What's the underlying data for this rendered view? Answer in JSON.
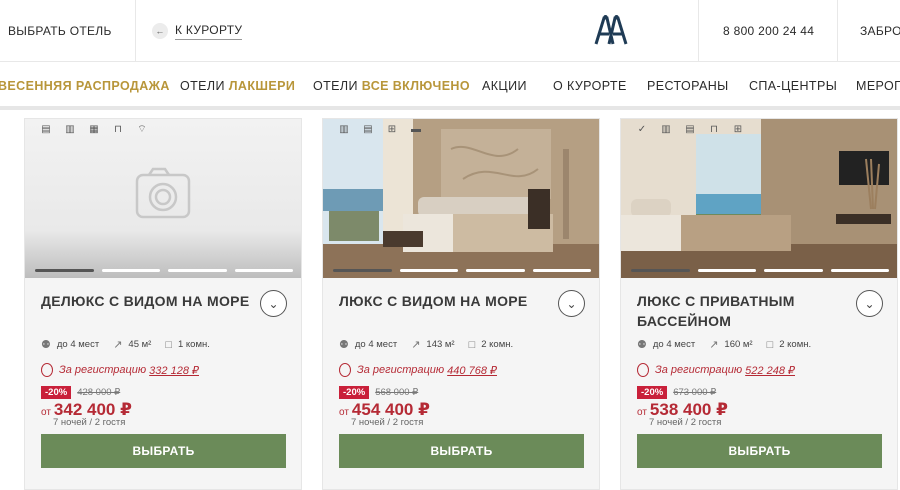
{
  "header": {
    "choose_hotel": "ВЫБРАТЬ ОТЕЛЬ",
    "back_to_resort": "К КУРОРТУ",
    "phone": "8 800 200 24 44",
    "booking_partial": "ЗАБРО"
  },
  "nav": {
    "items": [
      {
        "label": "ВЕСЕННЯЯ РАСПРОДАЖА"
      },
      {
        "prefix": "ОТЕЛИ ",
        "highlight": "ЛАКШЕРИ"
      },
      {
        "prefix": "ОТЕЛИ ",
        "highlight": "ВСЕ ВКЛЮЧЕНО"
      },
      {
        "label": "АКЦИИ"
      },
      {
        "label": "О КУРОРТЕ"
      },
      {
        "label": "РЕСТОРАНЫ"
      },
      {
        "label": "СПА-ЦЕНТРЫ"
      },
      {
        "label": "МЕРОП"
      }
    ]
  },
  "colors": {
    "accent_gold": "#b8963a",
    "price_red": "#b52a35",
    "badge_red": "#c9203a",
    "button_green": "#6b8b59"
  },
  "rooms": [
    {
      "title": "ДЕЛЮКС С ВИДОМ НА МОРЕ",
      "guests": "до 4 мест",
      "area": "45 м²",
      "rooms": "1 комн.",
      "reg_label": "За регистрацию",
      "reg_amount": "332 128 ₽",
      "discount": "-20%",
      "old_price": "428 000 ₽",
      "from": "от",
      "price": "342 400 ₽",
      "nights": "7 ночей / 2 гостя",
      "button": "ВЫБРАТЬ",
      "amenities": [
        "tv-icon",
        "radiator-icon",
        "safe-icon",
        "fridge-icon",
        "wifi-icon"
      ]
    },
    {
      "title": "ЛЮКС С ВИДОМ НА МОРЕ",
      "guests": "до 4 мест",
      "area": "143 м²",
      "rooms": "2 комн.",
      "reg_label": "За регистрацию",
      "reg_amount": "440 768 ₽",
      "discount": "-20%",
      "old_price": "568 000 ₽",
      "from": "от",
      "price": "454 400 ₽",
      "nights": "7 ночей / 2 гостя",
      "button": "ВЫБРАТЬ",
      "amenities": [
        "radiator-icon",
        "tv-icon",
        "kitchen-icon",
        "coffee-icon"
      ]
    },
    {
      "title": "ЛЮКС С ПРИВАТНЫМ БАССЕЙНОМ",
      "guests": "до 4 мест",
      "area": "160 м²",
      "rooms": "2 комн.",
      "reg_label": "За регистрацию",
      "reg_amount": "522 248 ₽",
      "discount": "-20%",
      "old_price": "673 000 ₽",
      "from": "от",
      "price": "538 400 ₽",
      "nights": "7 ночей / 2 гостя",
      "button": "ВЫБРАТЬ",
      "amenities": [
        "check-icon",
        "radiator-icon",
        "tv-icon",
        "fridge-icon",
        "kitchen-icon"
      ]
    }
  ]
}
